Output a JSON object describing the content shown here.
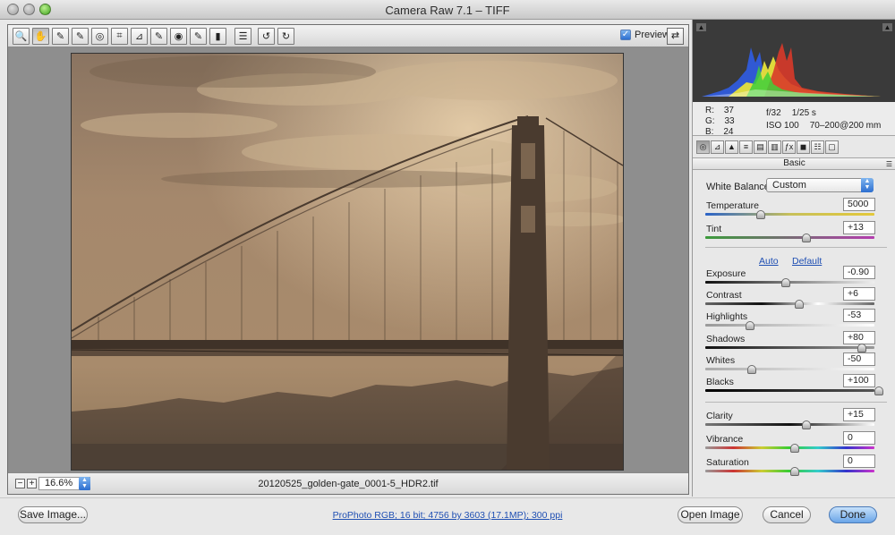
{
  "window": {
    "title": "Camera Raw 7.1  –  TIFF"
  },
  "toolbar": {
    "tools": [
      {
        "name": "zoom-tool",
        "glyph": "🔍"
      },
      {
        "name": "hand-tool",
        "glyph": "✋"
      },
      {
        "name": "white-balance-tool",
        "glyph": "✎"
      },
      {
        "name": "color-sampler-tool",
        "glyph": "✎"
      },
      {
        "name": "targeted-adjustment-tool",
        "glyph": "◎"
      },
      {
        "name": "crop-tool",
        "glyph": "⌗"
      },
      {
        "name": "straighten-tool",
        "glyph": "⊿"
      },
      {
        "name": "spot-removal-tool",
        "glyph": "✎"
      },
      {
        "name": "red-eye-tool",
        "glyph": "◉"
      },
      {
        "name": "adjustment-brush-tool",
        "glyph": "✎"
      },
      {
        "name": "graduated-filter-tool",
        "glyph": "▮"
      },
      {
        "name": "preferences-tool",
        "glyph": "☰"
      },
      {
        "name": "rotate-ccw-tool",
        "glyph": "↺"
      },
      {
        "name": "rotate-cw-tool",
        "glyph": "↻"
      }
    ],
    "preview_label": "Preview",
    "preview_checked": "✓",
    "fullscreen_glyph": "⇄"
  },
  "status": {
    "zoom_out": "−",
    "zoom_in": "+",
    "zoom_value": "16.6%",
    "filename": "20120525_golden-gate_0001-5_HDR2.tif"
  },
  "readout": {
    "r_label": "R:",
    "r_value": "37",
    "g_label": "G:",
    "g_value": "33",
    "b_label": "B:",
    "b_value": "24",
    "aperture": "f/32",
    "shutter": "1/25 s",
    "iso": "ISO 100",
    "lens": "70–200@200 mm"
  },
  "panel": {
    "section_title": "Basic",
    "tabs": [
      "basic",
      "tone-curve",
      "detail",
      "hsl",
      "split-toning",
      "lens-corrections",
      "effects",
      "camera-calibration",
      "presets",
      "snapshots"
    ],
    "white_balance_label": "White Balance:",
    "white_balance_value": "Custom",
    "auto_label": "Auto",
    "default_label": "Default",
    "sliders": [
      {
        "id": "temperature",
        "label": "Temperature",
        "value": "5000",
        "position": 0.3
      },
      {
        "id": "tint",
        "label": "Tint",
        "value": "+13",
        "position": 0.57
      },
      {
        "id": "exposure",
        "label": "Exposure",
        "value": "-0.90",
        "position": 0.45
      },
      {
        "id": "contrast",
        "label": "Contrast",
        "value": "+6",
        "position": 0.53
      },
      {
        "id": "highlights",
        "label": "Highlights",
        "value": "-53",
        "position": 0.24
      },
      {
        "id": "shadows",
        "label": "Shadows",
        "value": "+80",
        "position": 0.9
      },
      {
        "id": "whites",
        "label": "Whites",
        "value": "-50",
        "position": 0.25
      },
      {
        "id": "blacks",
        "label": "Blacks",
        "value": "+100",
        "position": 1.0
      },
      {
        "id": "clarity",
        "label": "Clarity",
        "value": "+15",
        "position": 0.57
      },
      {
        "id": "vibrance",
        "label": "Vibrance",
        "value": "0",
        "position": 0.5
      },
      {
        "id": "saturation",
        "label": "Saturation",
        "value": "0",
        "position": 0.5
      }
    ]
  },
  "bottom": {
    "save_label": "Save Image...",
    "info_link": "ProPhoto RGB; 16 bit; 4756 by 3603 (17.1MP); 300 ppi",
    "open_label": "Open Image",
    "cancel_label": "Cancel",
    "done_label": "Done"
  },
  "colors": {
    "accent": "#2d6fd0",
    "link": "#1f4fb3",
    "histogram_bg": "#3a3a3a",
    "photo_sky": "#a4876a",
    "photo_tower": "#4a3a2e"
  }
}
